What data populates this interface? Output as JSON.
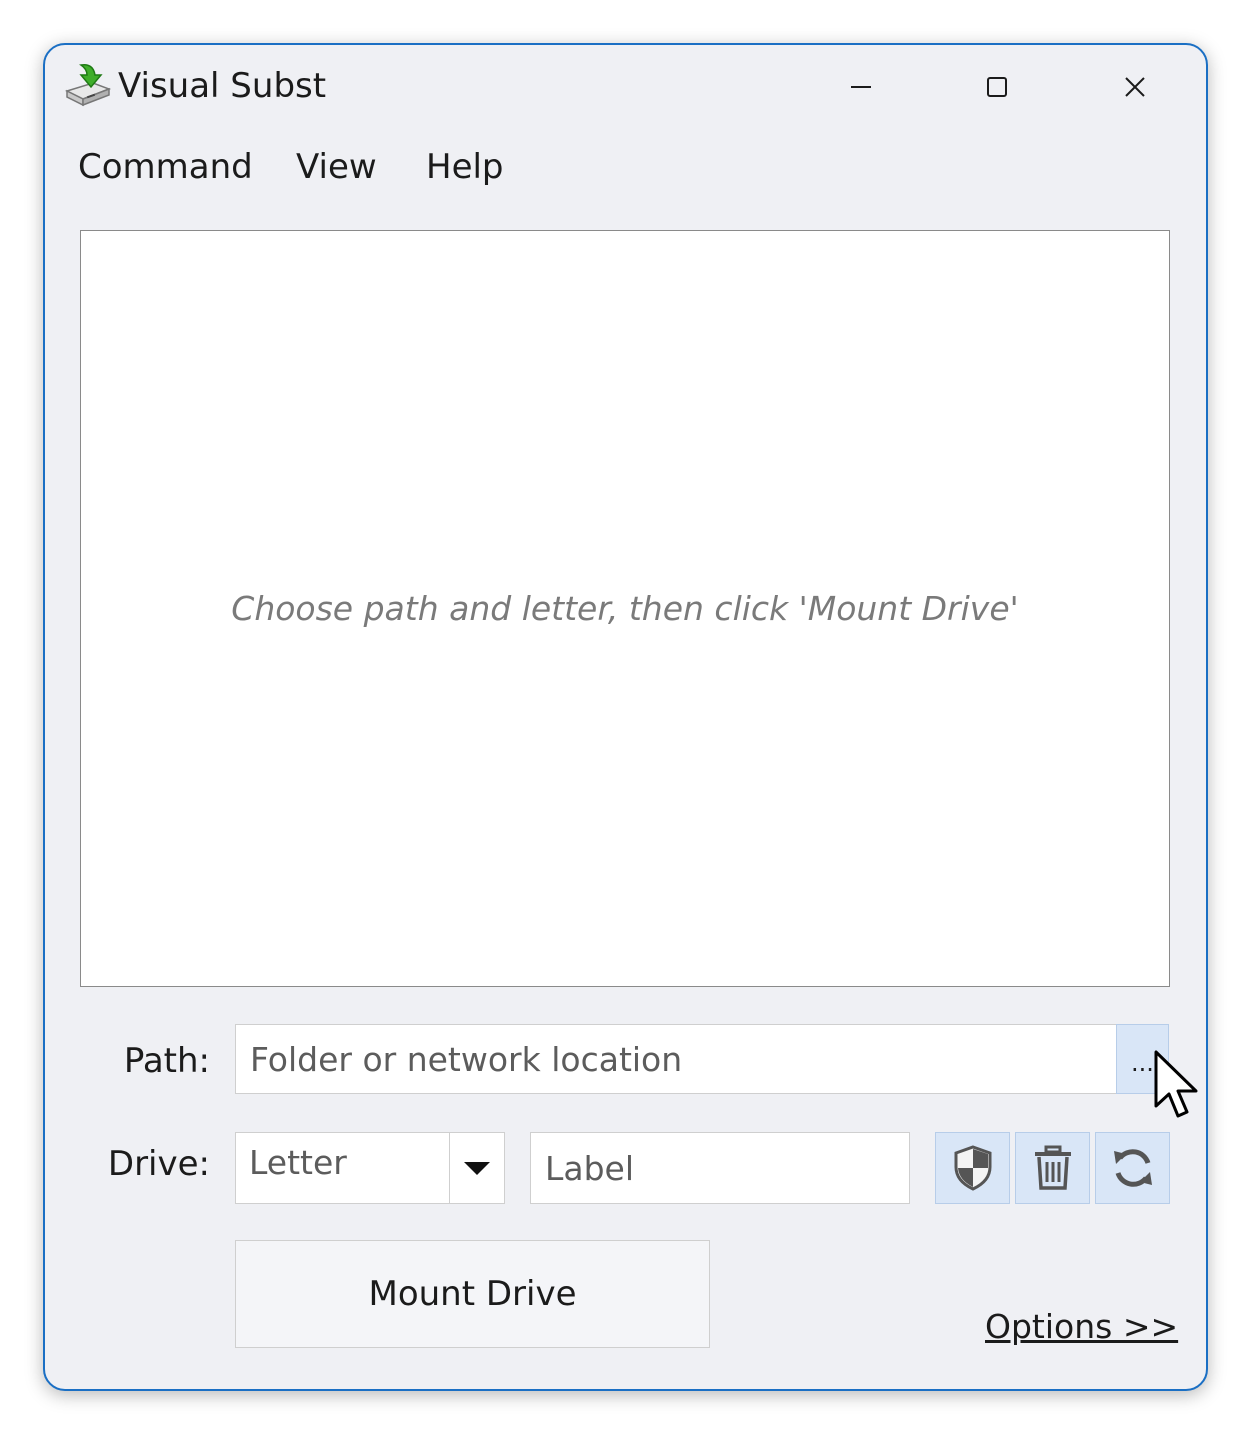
{
  "window": {
    "title": "Visual Subst",
    "app_icon": "drive-with-green-arrow-icon",
    "controls": {
      "minimize_icon": "minimize-icon",
      "maximize_icon": "maximize-icon",
      "close_icon": "close-icon"
    },
    "accent_color": "#1a6fc4"
  },
  "menu": {
    "items": [
      {
        "label": "Command"
      },
      {
        "label": "View"
      },
      {
        "label": "Help"
      }
    ]
  },
  "list": {
    "empty_hint": "Choose path and letter, then click 'Mount Drive'"
  },
  "path_row": {
    "label": "Path:",
    "placeholder": "Folder or network location",
    "value": "",
    "browse_label": "..."
  },
  "drive_row": {
    "label": "Drive:",
    "letter_placeholder": "Letter",
    "label_placeholder": "Label",
    "buttons": [
      {
        "icon": "shield-icon"
      },
      {
        "icon": "trash-icon"
      },
      {
        "icon": "refresh-icon"
      }
    ]
  },
  "actions": {
    "mount_label": "Mount Drive",
    "options_label": "Options >>"
  },
  "cursor": {
    "icon": "mouse-pointer-icon"
  }
}
